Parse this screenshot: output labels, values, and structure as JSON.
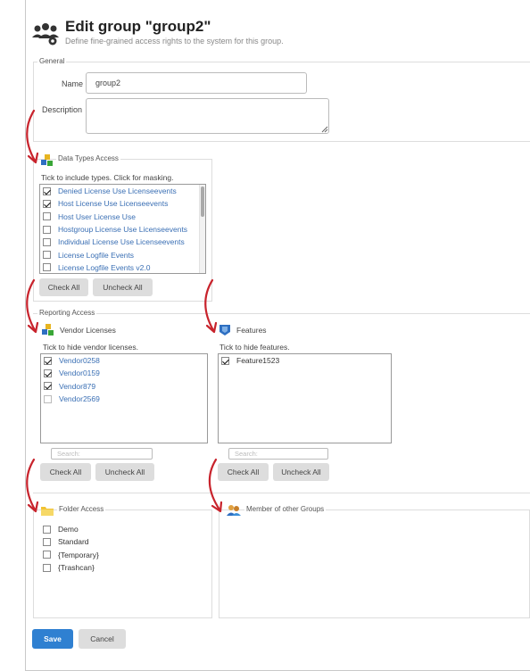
{
  "header": {
    "icon": "users-gear-icon",
    "title": "Edit group \"group2\"",
    "subtitle": "Define fine-grained access rights to the system for this group."
  },
  "general": {
    "legend": "General",
    "name_label": "Name",
    "name_value": "group2",
    "description_label": "Description",
    "description_value": ""
  },
  "data_types": {
    "legend": "Data Types Access",
    "hint": "Tick to include types. Click for masking.",
    "items": [
      {
        "label": "Denied License Use Licenseevents",
        "checked": true
      },
      {
        "label": "Host License Use Licenseevents",
        "checked": true
      },
      {
        "label": "Host User License Use",
        "checked": false
      },
      {
        "label": "Hostgroup License Use Licenseevents",
        "checked": false
      },
      {
        "label": "Individual License Use Licenseevents",
        "checked": false
      },
      {
        "label": "License Logfile Events",
        "checked": false
      },
      {
        "label": "License Logfile Events v2.0",
        "checked": false
      }
    ],
    "check_all": "Check All",
    "uncheck_all": "Uncheck All"
  },
  "reporting": {
    "legend": "Reporting Access",
    "vendors": {
      "title": "Vendor Licenses",
      "hint": "Tick to hide vendor licenses.",
      "items": [
        {
          "label": "Vendor0258",
          "checked": true
        },
        {
          "label": "Vendor0159",
          "checked": true
        },
        {
          "label": "Vendor879",
          "checked": true
        },
        {
          "label": "Vendor2569",
          "checked": false
        }
      ],
      "search_placeholder": "Search:",
      "check_all": "Check All",
      "uncheck_all": "Uncheck All"
    },
    "features": {
      "title": "Features",
      "hint": "Tick to hide features.",
      "items": [
        {
          "label": "Feature1523",
          "checked": true
        }
      ],
      "search_placeholder": "Search:",
      "check_all": "Check All",
      "uncheck_all": "Uncheck All"
    }
  },
  "folders": {
    "legend": "Folder Access",
    "items": [
      {
        "label": "Demo",
        "checked": false
      },
      {
        "label": "Standard",
        "checked": false
      },
      {
        "label": "{Temporary}",
        "checked": false
      },
      {
        "label": "{Trashcan}",
        "checked": false
      }
    ]
  },
  "groups": {
    "legend": "Member of other Groups"
  },
  "footer": {
    "save": "Save",
    "cancel": "Cancel"
  },
  "colors": {
    "primary": "#2f80d1",
    "link": "#3a6fb4",
    "annotation_arrow": "#c8232c"
  }
}
